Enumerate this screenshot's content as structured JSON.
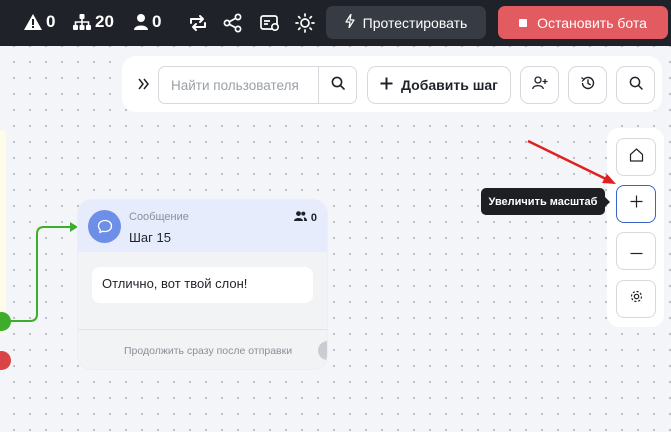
{
  "topbar": {
    "warnings_count": "0",
    "steps_count": "20",
    "users_count": "0",
    "test_button_label": "Протестировать",
    "stop_button_label": "Остановить бота"
  },
  "toolbar": {
    "search_placeholder": "Найти пользователя",
    "add_step_label": "Добавить шаг"
  },
  "zoom": {
    "tooltip": "Увеличить масштаб"
  },
  "node": {
    "type_label": "Сообщение",
    "title": "Шаг 15",
    "users_count": "0",
    "message": "Отлично, вот твой слон!",
    "footer": "Продолжить сразу после отправки"
  },
  "colors": {
    "topbar_bg": "#1f2329",
    "test_button_bg": "#363b44",
    "stop_button_bg": "#e25b61",
    "node_header_bg": "#e6ecfb",
    "node_avatar": "#6e8fe8",
    "connector_green": "#3fad2c",
    "port_red": "#d94545",
    "annotation_arrow": "#e0201f",
    "zoom_active_border": "#3b64c8"
  },
  "icons": {
    "topbar": [
      "warning-icon",
      "sitemap-icon",
      "user-icon",
      "repeat-icon",
      "share-icon",
      "settings-card-icon",
      "sun-icon",
      "lightning-icon",
      "stop-icon"
    ],
    "toolbar": [
      "chevrons-right-icon",
      "search-icon",
      "plus-icon",
      "user-add-icon",
      "history-clock-icon",
      "search-icon"
    ],
    "zoom": [
      "home-icon",
      "plus-icon",
      "minus-icon",
      "gear-icon"
    ],
    "node": [
      "chat-bubble-icon",
      "users-icon"
    ]
  }
}
